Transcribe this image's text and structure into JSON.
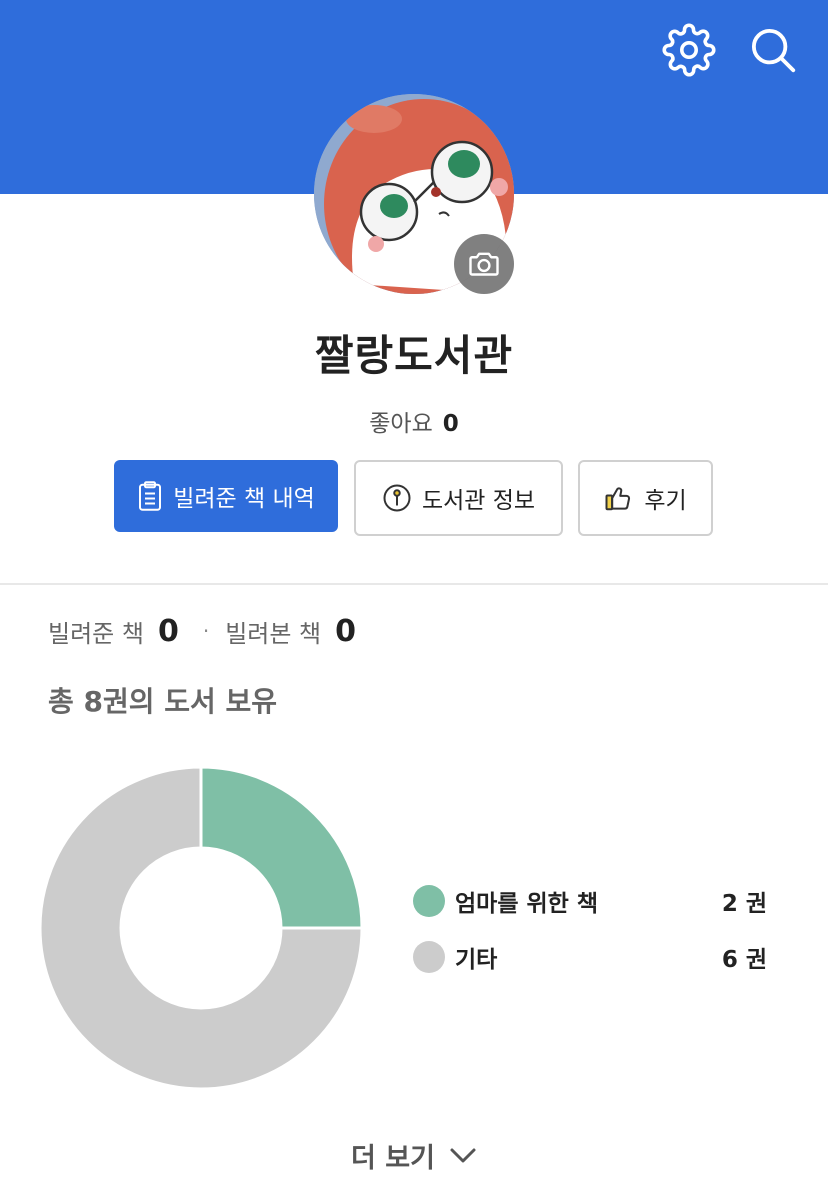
{
  "header": {
    "color": "#2f6ddb",
    "settings_icon": "gear-icon",
    "search_icon": "search-icon"
  },
  "profile": {
    "name": "짤랑도서관",
    "likes_label": "좋아요",
    "likes_count": "0",
    "camera_icon": "camera-icon"
  },
  "actions": {
    "lent_history": "빌려준 책 내역",
    "library_info": "도서관 정보",
    "reviews": "후기"
  },
  "stats": {
    "lent_label": "빌려준 책",
    "lent_count": "0",
    "borrowed_label": "빌려본 책",
    "borrowed_count": "0",
    "separator": "·"
  },
  "collection": {
    "total_text": "총 8권의 도서 보유"
  },
  "chart_data": {
    "type": "pie",
    "donut": true,
    "categories": [
      "엄마를 위한 책",
      "기타"
    ],
    "values": [
      2,
      6
    ],
    "colors": [
      "#7fbfa6",
      "#cccccc"
    ],
    "value_labels": [
      "2 권",
      "6 권"
    ],
    "legend_position": "right"
  },
  "more": {
    "label": "더 보기",
    "icon": "chevron-down-icon"
  }
}
